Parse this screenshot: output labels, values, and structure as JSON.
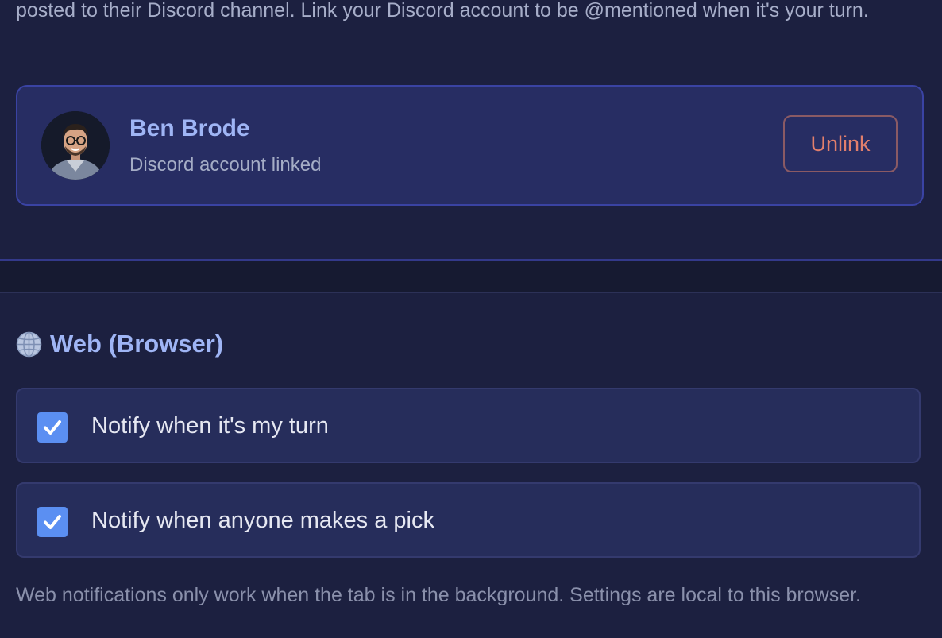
{
  "discord": {
    "intro_text": "posted to their Discord channel. Link your Discord account to be @mentioned when it's your turn.",
    "account": {
      "name": "Ben Brode",
      "status": "Discord account linked",
      "unlink_label": "Unlink"
    }
  },
  "web": {
    "icon": "globe-icon",
    "title": "Web (Browser)",
    "options": [
      {
        "label": "Notify when it's my turn",
        "checked": true
      },
      {
        "label": "Notify when anyone makes a pick",
        "checked": true
      }
    ],
    "footnote": "Web notifications only work when the tab is in the background. Settings are local to this browser."
  },
  "colors": {
    "background": "#1c2040",
    "card": "#272d63",
    "accent_text": "#9fb5f5",
    "danger_text": "#e27f6c",
    "checkbox": "#5b8ff2"
  }
}
